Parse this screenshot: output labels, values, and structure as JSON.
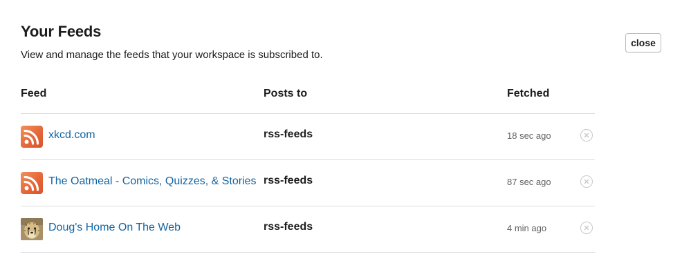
{
  "header": {
    "title": "Your Feeds",
    "subtitle": "View and manage the feeds that your workspace is subscribed to.",
    "close_label": "close"
  },
  "table": {
    "columns": {
      "feed": "Feed",
      "posts_to": "Posts to",
      "fetched": "Fetched"
    },
    "rows": [
      {
        "feed_name": "xkcd.com",
        "icon": "rss-icon",
        "posts_to": "rss-feeds",
        "fetched": "18 sec ago"
      },
      {
        "feed_name": "The Oatmeal - Comics, Quizzes, & Stories",
        "icon": "rss-icon",
        "posts_to": "rss-feeds",
        "fetched": "87 sec ago"
      },
      {
        "feed_name": "Doug's Home On The Web",
        "icon": "cheetah-avatar-icon",
        "posts_to": "rss-feeds",
        "fetched": "4 min ago"
      }
    ]
  },
  "colors": {
    "link": "#1264a3",
    "rss_orange": "#e5673a",
    "divider": "#dcdcdc",
    "muted_text": "#616061"
  }
}
